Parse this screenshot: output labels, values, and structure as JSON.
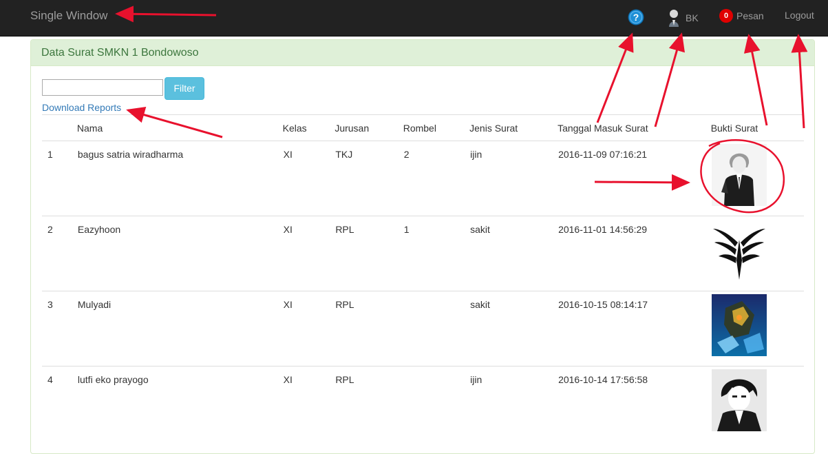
{
  "navbar": {
    "brand": "Single Window",
    "user_label": "BK",
    "messages_count": "0",
    "messages_label": "Pesan",
    "logout_label": "Logout"
  },
  "panel": {
    "title": "Data Surat SMKN 1 Bondowoso",
    "filter_value": "",
    "filter_button": "Filter",
    "download_link": "Download Reports"
  },
  "table": {
    "headers": [
      "",
      "Nama",
      "Kelas",
      "Jurusan",
      "Rombel",
      "Jenis Surat",
      "Tanggal Masuk Surat",
      "Bukti Surat"
    ],
    "rows": [
      {
        "no": "1",
        "nama": "bagus satria wiradharma",
        "kelas": "XI",
        "jurusan": "TKJ",
        "rombel": "2",
        "jenis": "ijin",
        "tanggal": "2016-11-09 07:16:21",
        "bukti": "anime-boy-suit-image"
      },
      {
        "no": "2",
        "nama": "Eazyhoon",
        "kelas": "XI",
        "jurusan": "RPL",
        "rombel": "1",
        "jenis": "sakit",
        "tanggal": "2016-11-01 14:56:29",
        "bukti": "tribal-wings-image"
      },
      {
        "no": "3",
        "nama": "Mulyadi",
        "kelas": "XI",
        "jurusan": "RPL",
        "rombel": "",
        "jenis": "sakit",
        "tanggal": "2016-10-15 08:14:17",
        "bukti": "robot-art-image"
      },
      {
        "no": "4",
        "nama": "lutfi eko prayogo",
        "kelas": "XI",
        "jurusan": "RPL",
        "rombel": "",
        "jenis": "ijin",
        "tanggal": "2016-10-14 17:56:58",
        "bukti": "anime-boy-portrait-image"
      }
    ]
  },
  "colors": {
    "navbar_bg": "#222222",
    "panel_heading_bg": "#dff0d8",
    "panel_heading_text": "#3c763d",
    "filter_button_bg": "#5bc0de",
    "link": "#337ab7",
    "annotation_red": "#e8112d"
  },
  "icons": {
    "help": "help-circle-icon",
    "user": "user-avatar-icon"
  }
}
